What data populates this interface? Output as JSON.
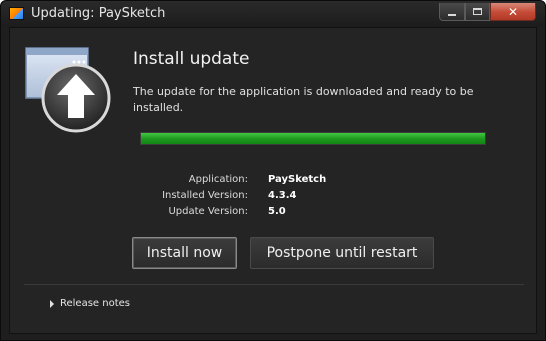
{
  "window": {
    "title": "Updating: PaySketch",
    "controls": {
      "minimize": "–",
      "maximize": "□",
      "close": "✕"
    },
    "accent_close": "#c44a36"
  },
  "update": {
    "heading": "Install update",
    "description": "The update for the application is downloaded and ready to be installed.",
    "progress": 1.0,
    "progress_color": "#1f9a1f",
    "details": [
      {
        "label": "Application:",
        "value": "PaySketch"
      },
      {
        "label": "Installed Version:",
        "value": "4.3.4"
      },
      {
        "label": "Update Version:",
        "value": "5.0"
      }
    ],
    "buttons": {
      "install": "Install now",
      "postpone": "Postpone until restart"
    },
    "release_notes": "Release notes",
    "icons": {
      "hero": "window-upload-icon",
      "expander": "triangle-right-icon",
      "app": "app-logo-icon"
    }
  }
}
